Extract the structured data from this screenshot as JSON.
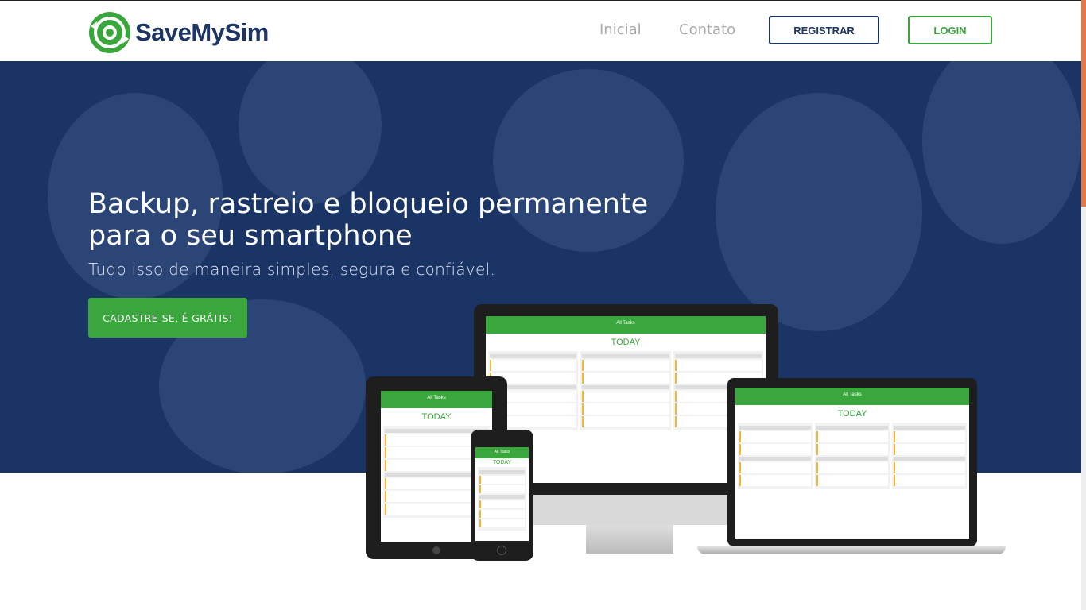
{
  "brand": {
    "name": "SaveMySim",
    "color": "#1c3565",
    "accent": "#3aa73c"
  },
  "nav": {
    "links": [
      "Inicial",
      "Contato"
    ],
    "register_label": "REGISTRAR",
    "login_label": "LOGIN"
  },
  "hero": {
    "title_line1": "Backup, rastreio e bloqueio permanente",
    "title_line2": "para o seu smartphone",
    "subtitle": "Tudo isso de maneira simples, segura e confiável.",
    "cta_label": "CADASTRE-SE, É GRÁTIS!",
    "background_color": "#1b3466"
  },
  "mockup_app": {
    "bar_title": "All Tasks",
    "today_label": "TODAY"
  }
}
